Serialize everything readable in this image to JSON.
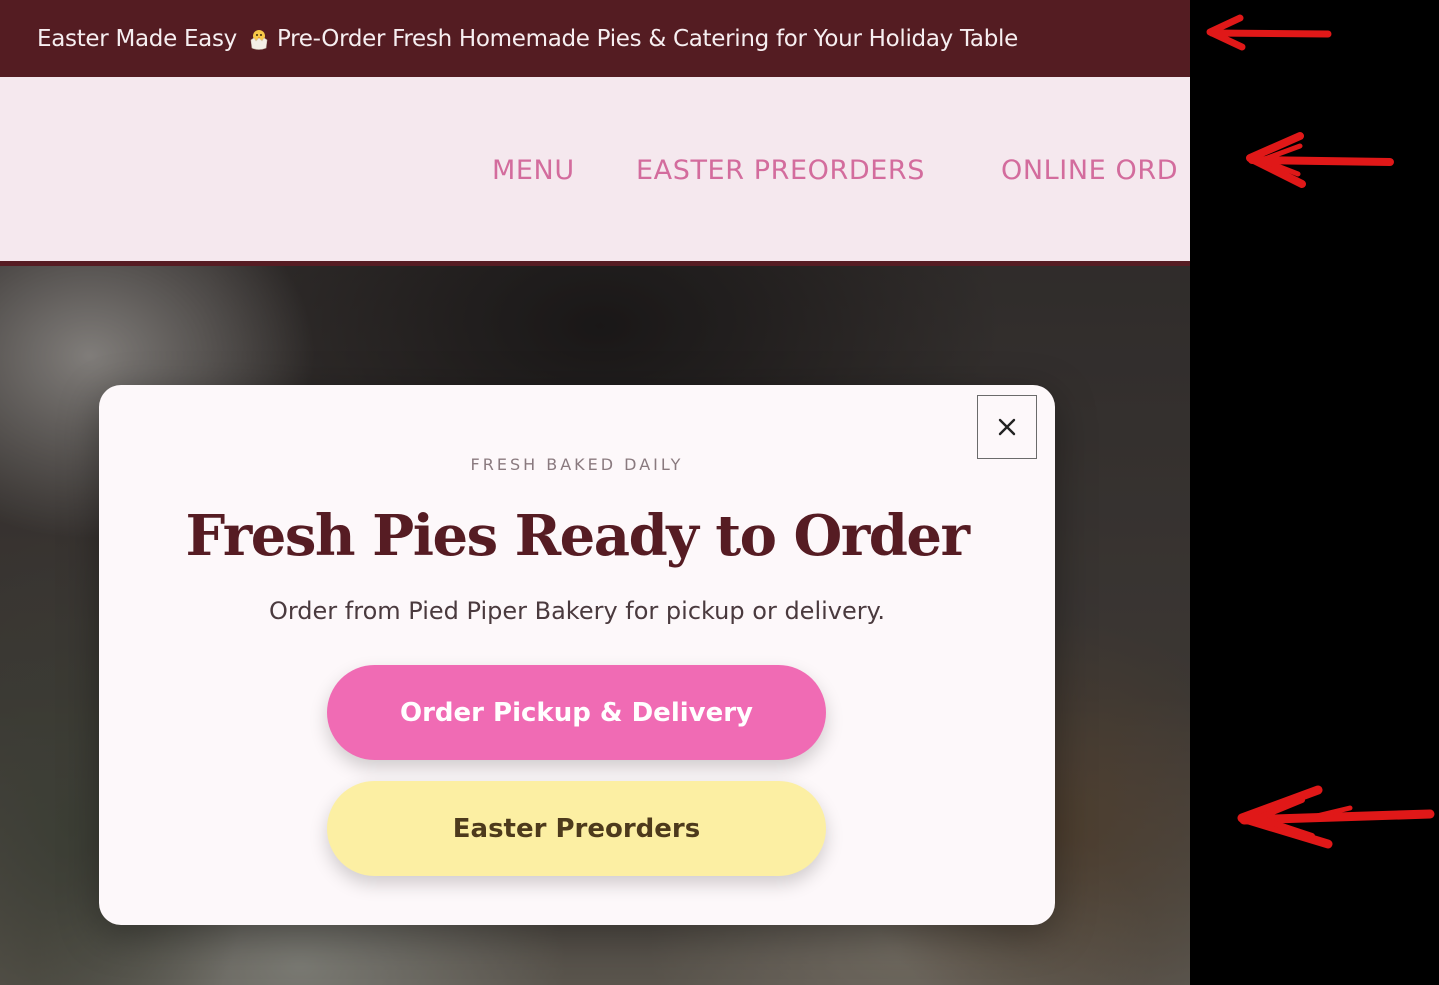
{
  "announcement": {
    "text_before": "Easter Made Easy",
    "icon": "hatching-chick-icon",
    "text_after": "Pre-Order Fresh Homemade Pies & Catering for Your Holiday Table"
  },
  "nav": {
    "items": [
      {
        "label": "MENU"
      },
      {
        "label": "EASTER PREORDERS"
      },
      {
        "label": "ONLINE ORD"
      }
    ]
  },
  "modal": {
    "eyebrow": "FRESH BAKED DAILY",
    "headline": "Fresh Pies Ready to Order",
    "subtext": "Order from Pied Piper Bakery for pickup or delivery.",
    "primary_button": "Order Pickup & Delivery",
    "secondary_button": "Easter Preorders",
    "close_icon": "close-icon"
  },
  "colors": {
    "brand_maroon": "#541c22",
    "nav_background": "#f5e8ee",
    "nav_text": "#d36c9d",
    "primary_button": "#f06bb4",
    "secondary_button": "#fcefa3",
    "annotation_arrows": "#e01818"
  },
  "annotations": {
    "arrow_icon": "left-arrow-icon",
    "count": 3
  }
}
